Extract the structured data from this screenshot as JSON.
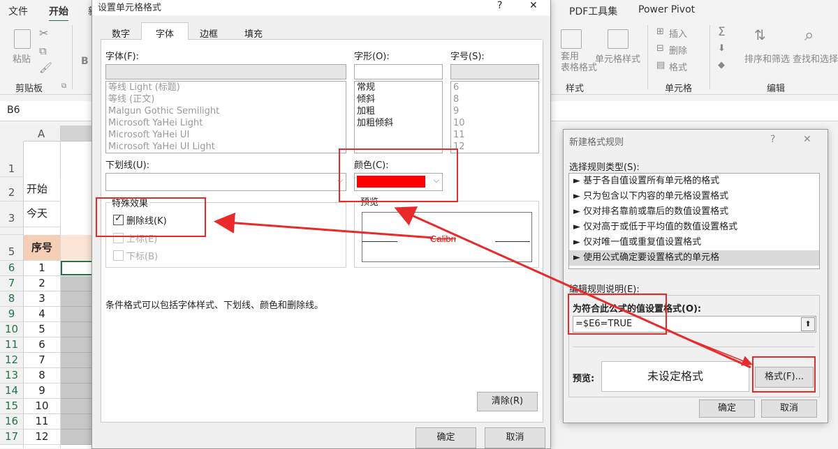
{
  "ribbon": {
    "tabs": [
      "文件",
      "开始",
      "新",
      "PDF工具集",
      "Power Pivot"
    ],
    "clipboard": {
      "paste": "粘贴",
      "label": "剪贴板"
    },
    "bold": "B",
    "styles": {
      "table_format": "套用\n表格格式",
      "cell_style": "单元格样式",
      "label": "样式"
    },
    "cells": {
      "insert": "插入",
      "delete": "删除",
      "format": "格式",
      "label": "单元格"
    },
    "edit": {
      "sort": "排序和筛选",
      "find": "查找和选择",
      "label": "编辑"
    }
  },
  "name_box": "B6",
  "grid": {
    "col_header": "A",
    "rows": [
      {
        "hdr": "1",
        "val": ""
      },
      {
        "hdr": "2",
        "val": "开始"
      },
      {
        "hdr": "3",
        "val": "今天"
      },
      {
        "hdr": "5",
        "val": "序号"
      },
      {
        "hdr": "6",
        "val": "1"
      },
      {
        "hdr": "7",
        "val": "2"
      },
      {
        "hdr": "8",
        "val": "3"
      },
      {
        "hdr": "9",
        "val": "4"
      },
      {
        "hdr": "10",
        "val": "5"
      },
      {
        "hdr": "11",
        "val": "6"
      },
      {
        "hdr": "12",
        "val": "7"
      },
      {
        "hdr": "13",
        "val": "8"
      },
      {
        "hdr": "14",
        "val": "9"
      },
      {
        "hdr": "15",
        "val": "10"
      },
      {
        "hdr": "16",
        "val": "11"
      },
      {
        "hdr": "17",
        "val": "12"
      }
    ]
  },
  "format_dialog": {
    "title": "设置单元格格式",
    "help": "?",
    "close": "✕",
    "tabs": [
      "数字",
      "字体",
      "边框",
      "填充"
    ],
    "font_label": "字体(F):",
    "fonts": [
      "等线 Light (标题)",
      "等线 (正文)",
      "Malgun Gothic Semilight",
      "Microsoft YaHei Light",
      "Microsoft YaHei UI",
      "Microsoft YaHei UI Light"
    ],
    "style_label": "字形(O):",
    "styles": [
      "常规",
      "倾斜",
      "加粗",
      "加粗倾斜"
    ],
    "size_label": "字号(S):",
    "sizes": [
      "6",
      "8",
      "9",
      "10",
      "11",
      "12"
    ],
    "underline_label": "下划线(U):",
    "color_label": "颜色(C):",
    "color_value": "#ff0000",
    "effects_label": "特殊效果",
    "strikethrough": "删除线(K)",
    "superscript": "上标(E)",
    "subscript": "下标(B)",
    "preview_label": "预览",
    "preview_text": "Calibri",
    "note": "条件格式可以包括字体样式、下划线、颜色和删除线。",
    "clear_btn": "清除(R)",
    "ok_btn": "确定",
    "cancel_btn": "取消"
  },
  "rule_dialog": {
    "title": "新建格式规则",
    "help": "?",
    "close": "✕",
    "type_label": "选择规则类型(S):",
    "rule_types": [
      "► 基于各自值设置所有单元格的格式",
      "► 只为包含以下内容的单元格设置格式",
      "► 仅对排名靠前或靠后的数值设置格式",
      "► 仅对高于或低于平均值的数值设置格式",
      "► 仅对唯一值或重复值设置格式",
      "► 使用公式确定要设置格式的单元格"
    ],
    "desc_label": "编辑规则说明(E):",
    "formula_label": "为符合此公式的值设置格式(O):",
    "formula": "=$E6=TRUE",
    "preview_label": "预览:",
    "preview_text": "未设定格式",
    "format_btn": "格式(F)...",
    "ok_btn": "确定",
    "cancel_btn": "取消"
  },
  "colors": {
    "accent_green": "#217346",
    "highlight_red": "#e82a2a"
  }
}
